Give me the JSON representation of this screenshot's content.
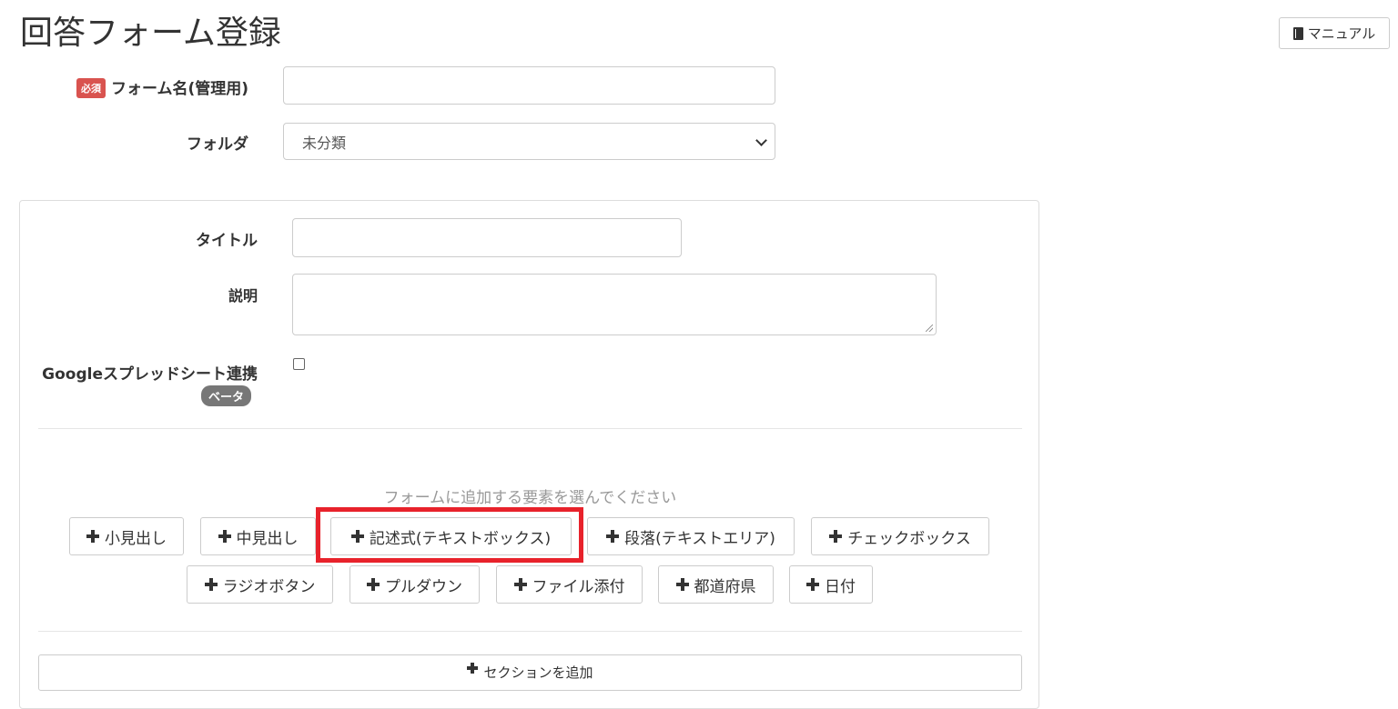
{
  "page": {
    "title": "回答フォーム登録",
    "manual_label": "マニュアル"
  },
  "form": {
    "required_badge": "必須",
    "form_name_label": "フォーム名(管理用)",
    "form_name_value": "",
    "folder_label": "フォルダ",
    "folder_selected": "未分類"
  },
  "panel": {
    "title_label": "タイトル",
    "title_value": "",
    "description_label": "説明",
    "description_value": "",
    "google_sheets_label": "Googleスプレッドシート連携",
    "google_sheets_checked": false,
    "beta_badge": "ベータ",
    "hint": "フォームに追加する要素を選んでください",
    "element_buttons": [
      "小見出し",
      "中見出し",
      "記述式(テキストボックス)",
      "段落(テキストエリア)",
      "チェックボックス",
      "ラジオボタン",
      "プルダウン",
      "ファイル添付",
      "都道府県",
      "日付"
    ],
    "add_section_label": "セクションを追加"
  },
  "colors": {
    "required": "#d9534f",
    "highlight": "#e8222b",
    "beta": "#777777"
  }
}
